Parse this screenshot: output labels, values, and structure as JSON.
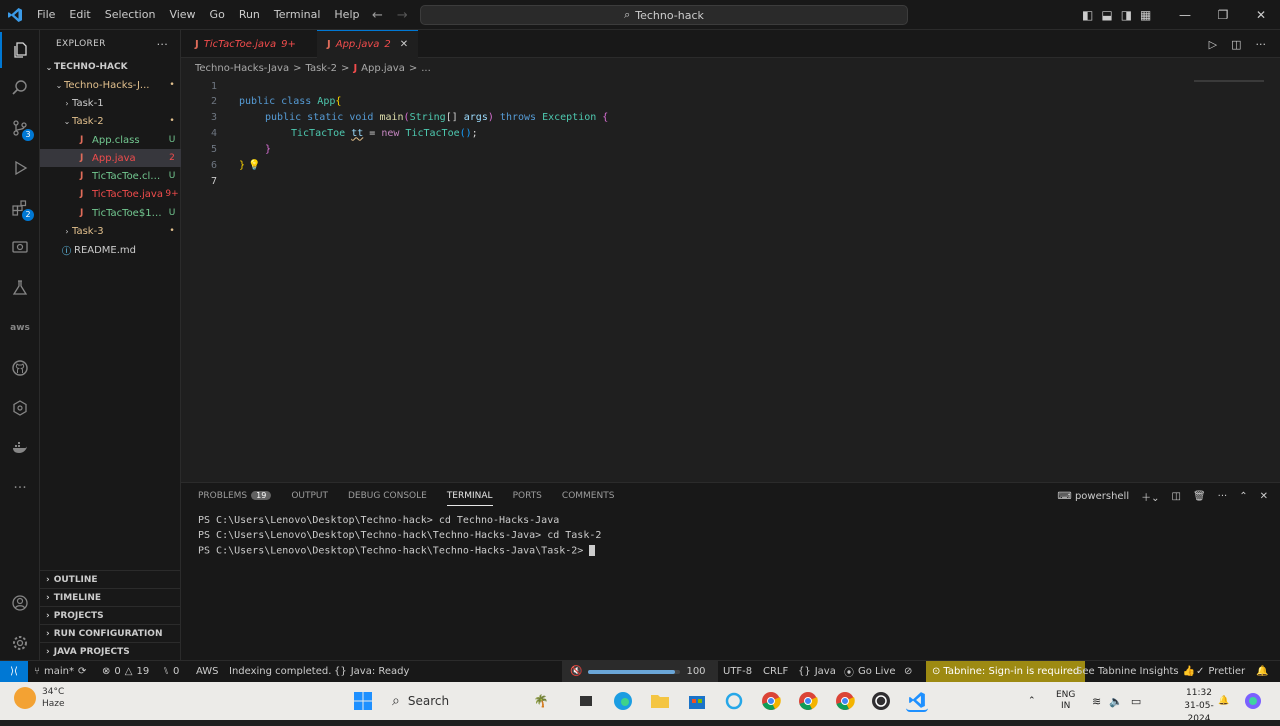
{
  "titlebar": {
    "menu": [
      "File",
      "Edit",
      "Selection",
      "View",
      "Go",
      "Run",
      "Terminal",
      "Help"
    ],
    "search": "Techno-hack"
  },
  "explorer": {
    "title": "EXPLORER",
    "root": "TECHNO-HACK",
    "items": [
      {
        "label": "Techno-Hacks-J...",
        "status": "•"
      },
      {
        "label": "Task-1",
        "status": ""
      },
      {
        "label": "Task-2",
        "status": "•"
      },
      {
        "label": "App.class",
        "status": "U"
      },
      {
        "label": "App.java",
        "status": "2"
      },
      {
        "label": "TicTacToe.class",
        "status": "U"
      },
      {
        "label": "TicTacToe.java",
        "status": "9+"
      },
      {
        "label": "TicTacToe$1.cl...",
        "status": "U"
      },
      {
        "label": "Task-3",
        "status": "•"
      },
      {
        "label": "README.md",
        "status": ""
      }
    ],
    "sections": [
      "OUTLINE",
      "TIMELINE",
      "PROJECTS",
      "RUN CONFIGURATION",
      "JAVA PROJECTS"
    ]
  },
  "tabs": [
    {
      "name": "TicTacToe.java",
      "badge": "9+"
    },
    {
      "name": "App.java",
      "badge": "2"
    }
  ],
  "breadcrumb": [
    "Techno-Hacks-Java",
    ">",
    "Task-2",
    ">",
    "App.java",
    ">",
    "..."
  ],
  "code": {
    "line_numbers": [
      "1",
      "2",
      "3",
      "4",
      "5",
      "6",
      "7"
    ],
    "l2": {
      "a": "public",
      "b": " ",
      "c": "class",
      "d": " ",
      "e": "App",
      "f": "{"
    },
    "l3": {
      "a": "public",
      "b": " ",
      "c": "static",
      "d": " ",
      "e": "void",
      "f": " ",
      "g": "main",
      "h": "(",
      "i": "String",
      "j": "[]",
      "k": " ",
      "l": "args",
      "m": ")",
      "n": " ",
      "o": "throws",
      "p": " ",
      "q": "Exception",
      "r": " ",
      "s": "{"
    },
    "l4": {
      "a": "TicTacToe",
      "b": " ",
      "c": "tt",
      "d": " = ",
      "e": "new",
      "f": " ",
      "g": "TicTacToe",
      "h": "()",
      "i": ";"
    },
    "l5": "}",
    "l6": "}"
  },
  "panel": {
    "tabs": [
      "PROBLEMS",
      "OUTPUT",
      "DEBUG CONSOLE",
      "TERMINAL",
      "PORTS",
      "COMMENTS"
    ],
    "problems_count": "19",
    "shell": "powershell",
    "terminal_lines": [
      "PS C:\\Users\\Lenovo\\Desktop\\Techno-hack> cd Techno-Hacks-Java",
      "PS C:\\Users\\Lenovo\\Desktop\\Techno-hack\\Techno-Hacks-Java> cd Task-2",
      "PS C:\\Users\\Lenovo\\Desktop\\Techno-hack\\Techno-Hacks-Java\\Task-2> "
    ]
  },
  "statusbar": {
    "branch": "main*",
    "errors": "0",
    "warnings": "19",
    "ports": "0",
    "aws": "AWS",
    "indexing": "Indexing completed.",
    "java": "Java: Ready",
    "volume": "100",
    "volume_level": 0.95,
    "encoding": "UTF-8",
    "eol": "CRLF",
    "language": "Java",
    "golive": "Go Live",
    "tabnine": "Tabnine: Sign-in is required",
    "insights": "See Tabnine Insights",
    "prettier": "Prettier"
  },
  "taskbar": {
    "temp": "34°C",
    "weather": "Haze",
    "search": "Search",
    "lang1": "ENG",
    "lang2": "IN",
    "time": "11:32",
    "date": "31-05-2024"
  },
  "colors": {
    "accent": "#0078d4",
    "tabnine": "#9d8a12"
  }
}
